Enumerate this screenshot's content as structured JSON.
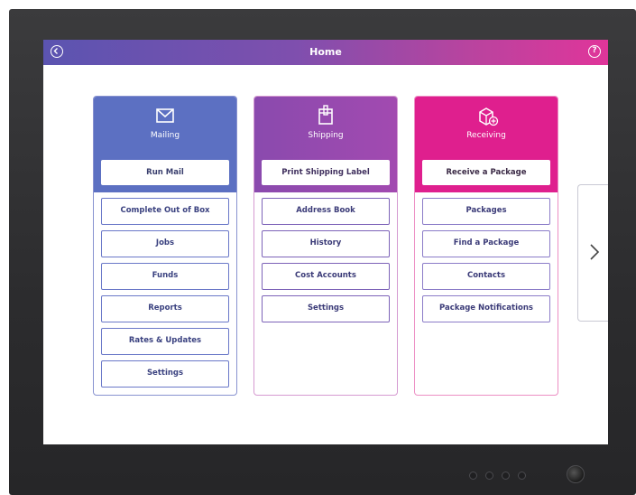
{
  "header": {
    "title": "Home",
    "back_icon": "back-icon",
    "help_icon": "help-icon",
    "help_glyph": "?",
    "gradient_colors": [
      "#5b54b0",
      "#b8449f",
      "#e0359a"
    ]
  },
  "cards": {
    "mailing": {
      "label": "Mailing",
      "icon": "envelope-icon",
      "color": "#5c70c2",
      "primary_action": "Run Mail",
      "items": [
        "Complete Out of Box",
        "Jobs",
        "Funds",
        "Reports",
        "Rates & Updates",
        "Settings"
      ]
    },
    "shipping": {
      "label": "Shipping",
      "icon": "package-icon",
      "color": "#9a4ab0",
      "primary_action": "Print Shipping Label",
      "items": [
        "Address Book",
        "History",
        "Cost Accounts",
        "Settings"
      ]
    },
    "receiving": {
      "label": "Receiving",
      "icon": "receive-package-icon",
      "color": "#df1f8e",
      "primary_action": "Receive a Package",
      "items": [
        "Packages",
        "Find a Package",
        "Contacts",
        "Package Notifications"
      ]
    }
  },
  "navigation": {
    "next_icon": "chevron-right-icon"
  }
}
